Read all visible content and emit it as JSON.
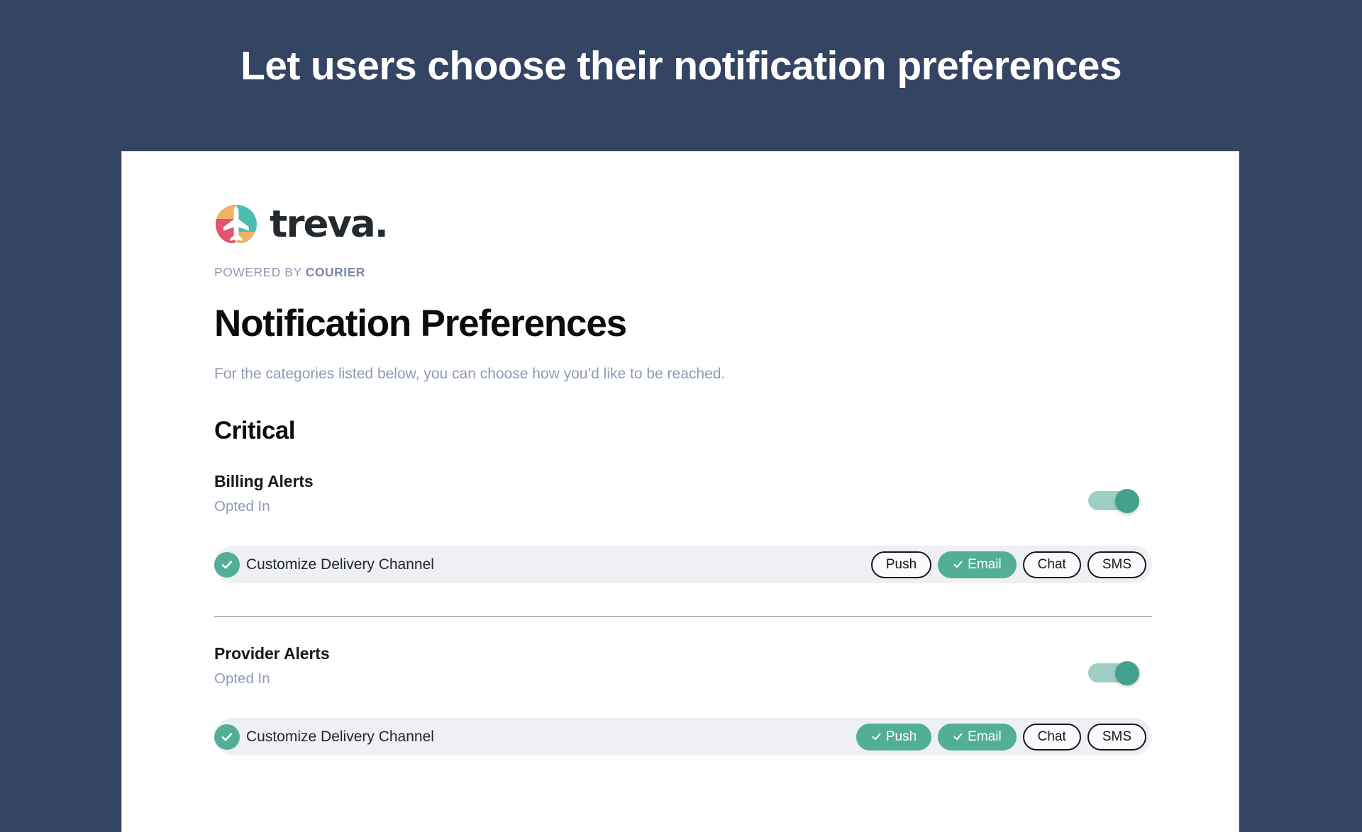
{
  "page": {
    "headline": "Let users choose their notification preferences",
    "background_color": "#344463"
  },
  "card": {
    "brand": {
      "wordmark": "treva.",
      "logo_icon": "treva-lungs-airplane-logo",
      "logo_colors": {
        "teal": "#4EBDB1",
        "orange": "#F0B263",
        "pink": "#E0556E"
      }
    },
    "powered_by": {
      "prefix": "POWERED BY",
      "brand": "COURIER"
    },
    "title": "Notification Preferences",
    "subtitle": "For the categories listed below, you can choose how you’d like to be reached.",
    "accent_color": "#53ae97",
    "groups": [
      {
        "name": "Critical",
        "topics": [
          {
            "name": "Billing Alerts",
            "status": "Opted In",
            "toggle_on": true,
            "delivery": {
              "label": "Customize Delivery Channel",
              "enabled": true,
              "channels": [
                {
                  "label": "Push",
                  "selected": false
                },
                {
                  "label": "Email",
                  "selected": true
                },
                {
                  "label": "Chat",
                  "selected": false
                },
                {
                  "label": "SMS",
                  "selected": false
                }
              ]
            },
            "divider_after": true
          },
          {
            "name": "Provider Alerts",
            "status": "Opted In",
            "toggle_on": true,
            "delivery": {
              "label": "Customize Delivery Channel",
              "enabled": true,
              "channels": [
                {
                  "label": "Push",
                  "selected": true
                },
                {
                  "label": "Email",
                  "selected": true
                },
                {
                  "label": "Chat",
                  "selected": false
                },
                {
                  "label": "SMS",
                  "selected": false
                }
              ]
            },
            "divider_after": false
          }
        ]
      }
    ]
  }
}
